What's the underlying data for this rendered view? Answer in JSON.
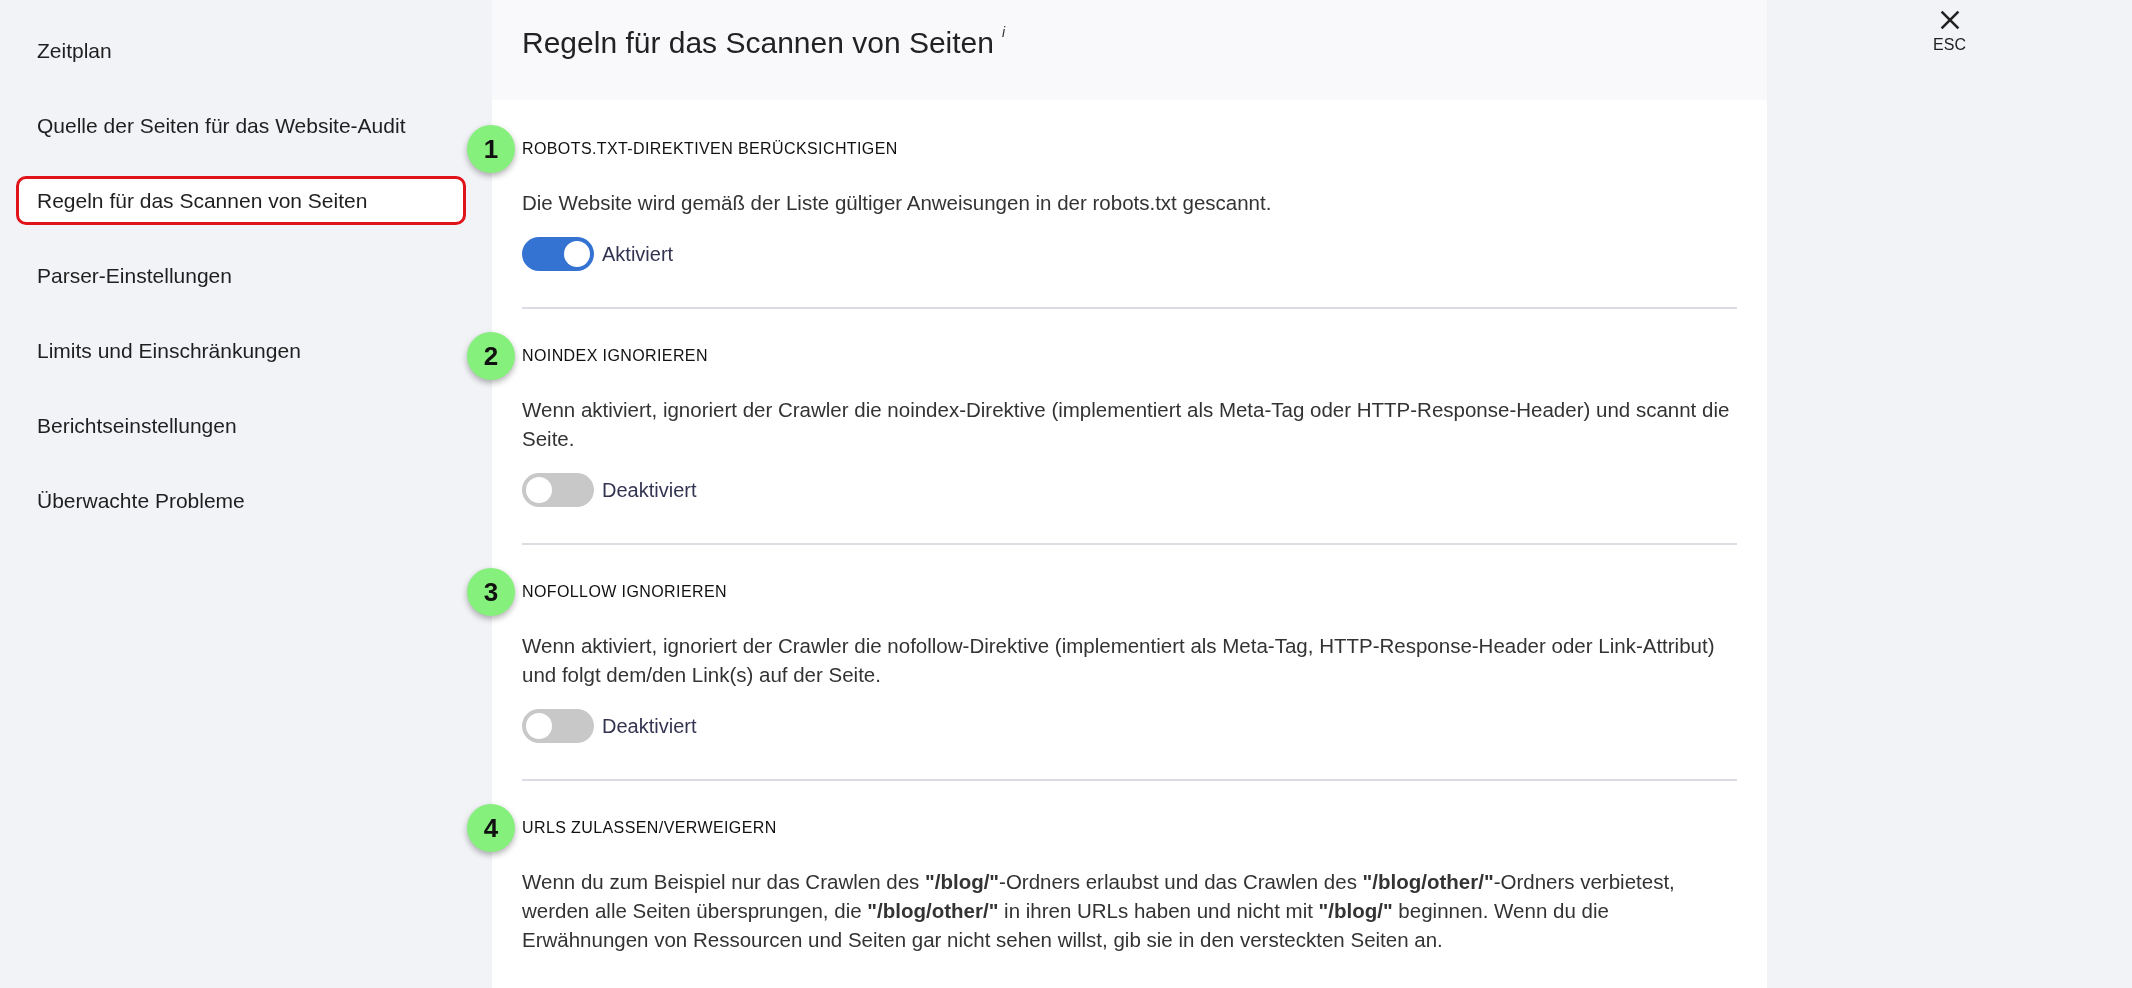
{
  "sidebar": {
    "items": [
      {
        "label": "Zeitplan",
        "selected": false
      },
      {
        "label": "Quelle der Seiten für das Website-Audit",
        "selected": false
      },
      {
        "label": "Regeln für das Scannen von Seiten",
        "selected": true
      },
      {
        "label": "Parser-Einstellungen",
        "selected": false
      },
      {
        "label": "Limits und Einschränkungen",
        "selected": false
      },
      {
        "label": "Berichtseinstellungen",
        "selected": false
      },
      {
        "label": "Überwachte Probleme",
        "selected": false
      }
    ]
  },
  "header": {
    "title": "Regeln für das Scannen von Seiten",
    "info_mark": "i"
  },
  "sections": [
    {
      "marker": "1",
      "title": "ROBOTS.TXT-DIREKTIVEN BERÜCKSICHTIGEN",
      "description": "Die Website wird gemäß der Liste gültiger Anweisungen in der robots.txt gescannt.",
      "toggle": {
        "on": true,
        "label": "Aktiviert"
      }
    },
    {
      "marker": "2",
      "title": "NOINDEX IGNORIEREN",
      "description": "Wenn aktiviert, ignoriert der Crawler die noindex-Direktive (implementiert als Meta-Tag oder HTTP-Response-Header) und scannt die Seite.",
      "toggle": {
        "on": false,
        "label": "Deaktiviert"
      }
    },
    {
      "marker": "3",
      "title": "NOFOLLOW IGNORIEREN",
      "description": "Wenn aktiviert, ignoriert der Crawler die nofollow-Direktive (implementiert als Meta-Tag, HTTP-Response-Header oder Link-Attribut) und folgt dem/den Link(s) auf der Seite.",
      "toggle": {
        "on": false,
        "label": "Deaktiviert"
      }
    },
    {
      "marker": "4",
      "title": "URLS ZULASSEN/VERWEIGERN",
      "description": "Wenn du zum Beispiel nur das Crawlen des **\"/blog/\"**-Ordners erlaubst und das Crawlen des **\"/blog/other/\"**-Ordners verbietest, werden alle Seiten übersprungen, die **\"/blog/other/\"** in ihren URLs haben und nicht mit **\"/blog/\"** beginnen. Wenn du die Erwähnungen von Ressourcen und Seiten gar nicht sehen willst, gib sie in den versteckten Seiten an."
    }
  ],
  "close": {
    "label": "ESC"
  }
}
